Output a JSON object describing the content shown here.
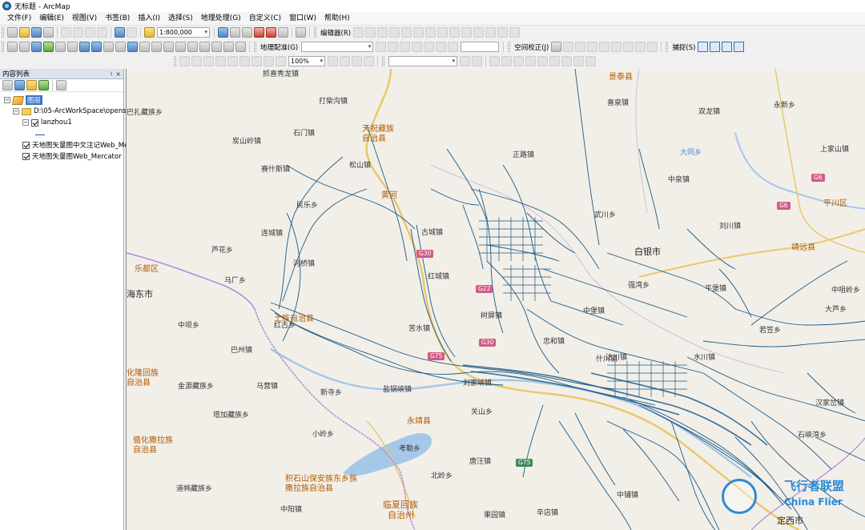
{
  "window": {
    "title": "无标题 - ArcMap"
  },
  "menu": [
    "文件(F)",
    "编辑(E)",
    "视图(V)",
    "书签(B)",
    "插入(I)",
    "选择(S)",
    "地理处理(G)",
    "自定义(C)",
    "窗口(W)",
    "帮助(H)"
  ],
  "toolbar": {
    "scale": "1:800,000",
    "editor_label": "编辑器(R)",
    "georef_label": "地理配准(G)",
    "spatial_adjust_label": "空间校正(J)",
    "snapping_label": "捕捉(S)",
    "zoom_level": "100%"
  },
  "toc": {
    "title": "内容列表",
    "pin_symbol": "♮",
    "close_symbol": "×",
    "data_frame": "图层",
    "folder": "D:\\05-ArcWorkSpace\\openst",
    "layers": [
      {
        "name": "lanzhou1",
        "checked": true
      },
      {
        "name": "天地图矢量图中文注记Web_Me",
        "checked": true
      },
      {
        "name": "天地图矢量图Web_Mercator",
        "checked": true
      }
    ]
  },
  "map": {
    "places": [
      "抓喜秀龙镇",
      "打柴沟镇",
      "天祝藏族",
      "自治县",
      "石门镇",
      "炭山岭镇",
      "赛什斯镇",
      "松山镇",
      "民乐乡",
      "连城镇",
      "河桥镇",
      "马厂乡",
      "古城镇",
      "红城镇",
      "苦水镇",
      "树屏镇",
      "忠和镇",
      "中堡镇",
      "达川镇",
      "盐锅峡镇",
      "永靖县",
      "关山乡",
      "刘家峡镇",
      "红古乡",
      "巴州镇",
      "金源藏族乡",
      "马营镇",
      "新寺乡",
      "塔加藏族乡",
      "小岭乡",
      "考勒乡",
      "唐汪镇",
      "北岭乡",
      "中铺镇",
      "中阳镇",
      "果园镇",
      "辛店镇",
      "景泰县",
      "喜泉镇",
      "双龙镇",
      "永新乡",
      "正路镇",
      "中泉镇",
      "上家山镇",
      "武川乡",
      "刘川镇",
      "平川区",
      "白银市",
      "靖远县",
      "强湾乡",
      "平堡镇",
      "大芦乡",
      "若笠乡",
      "什川镇",
      "水川镇",
      "汉家岔镇",
      "石峡湾乡",
      "定西市",
      "乐都区",
      "海东市",
      "土族自治县",
      "循化撒拉族",
      "自治县",
      "积石山保安族东乡族",
      "撒拉族自治县",
      "临夏回族",
      "自治州",
      "化隆回族",
      "自治县",
      "芦花乡",
      "中坝乡",
      "巴扎藏族乡",
      "道帏藏族乡",
      "中咀岭乡",
      "大同乡",
      "黄河",
      "永登县",
      "兰州市"
    ],
    "shields": [
      "G30",
      "G6",
      "G6",
      "G75",
      "G22",
      "G30",
      "G75"
    ]
  },
  "watermark": {
    "cn": "飞行者联盟",
    "en": "China Flier"
  },
  "colors": {
    "selected_layer": "#3a74c4",
    "route": "#1b5a86",
    "water": "#a6c8e8",
    "boundary": "#b18ad6"
  }
}
